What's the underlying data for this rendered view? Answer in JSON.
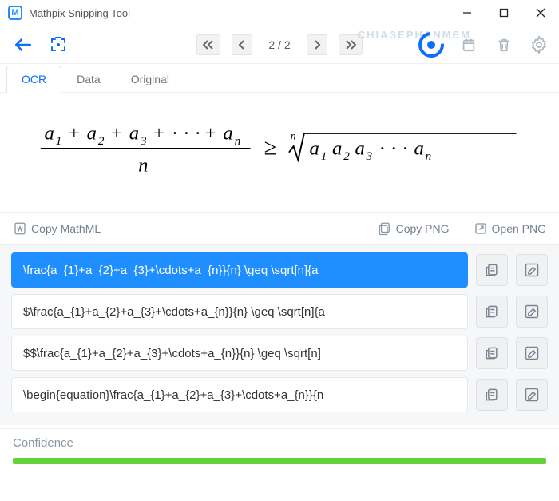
{
  "window": {
    "title": "Mathpix Snipping Tool"
  },
  "toolbar": {
    "page_counter": "2 / 2",
    "watermark": "CHIASEPHANMEM"
  },
  "tabs": [
    {
      "id": "ocr",
      "label": "OCR",
      "active": true
    },
    {
      "id": "data",
      "label": "Data",
      "active": false
    },
    {
      "id": "original",
      "label": "Original",
      "active": false
    }
  ],
  "actions": {
    "copy_mathml": "Copy MathML",
    "copy_png": "Copy PNG",
    "open_png": "Open PNG"
  },
  "formula": {
    "latex_display": "\\frac{a_{1}+a_{2}+a_{3}+\\cdots+a_{n}}{n} \\geq \\sqrt[n]{a_{1} a_{2} a_{3} \\cdots a_{n}}"
  },
  "results": [
    {
      "text": "\\frac{a_{1}+a_{2}+a_{3}+\\cdots+a_{n}}{n} \\geq \\sqrt[n]{a_",
      "selected": true
    },
    {
      "text": "$\\frac{a_{1}+a_{2}+a_{3}+\\cdots+a_{n}}{n} \\geq \\sqrt[n]{a",
      "selected": false
    },
    {
      "text": "$$\\frac{a_{1}+a_{2}+a_{3}+\\cdots+a_{n}}{n} \\geq \\sqrt[n]",
      "selected": false
    },
    {
      "text": "\\begin{equation}\\frac{a_{1}+a_{2}+a_{3}+\\cdots+a_{n}}{n",
      "selected": false
    }
  ],
  "confidence": {
    "label": "Confidence",
    "percent": 100
  }
}
